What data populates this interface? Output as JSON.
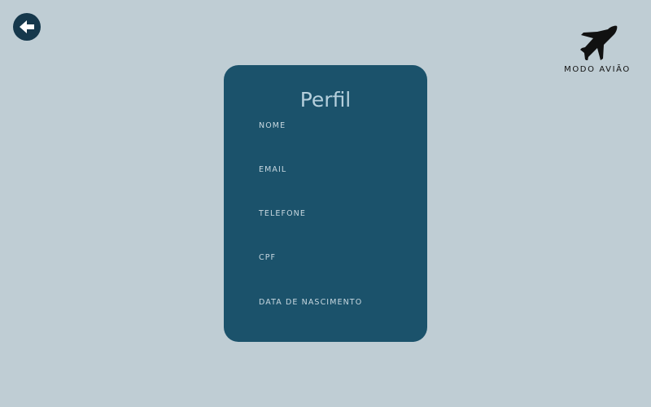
{
  "header": {
    "back_icon": "arrow-left-icon",
    "brand": {
      "logo_icon": "airplane-icon",
      "name": "MODO AVIÃO"
    }
  },
  "profile": {
    "title": "Perfil",
    "fields": [
      {
        "label": "NOME"
      },
      {
        "label": "EMAIL"
      },
      {
        "label": "TELEFONE"
      },
      {
        "label": "CPF"
      },
      {
        "label": "DATA DE NASCIMENTO"
      }
    ]
  },
  "colors": {
    "background": "#bfcdd4",
    "card": "#1b526b",
    "title": "#b5cfdc",
    "back_button": "#16384c",
    "logo": "#111111"
  }
}
